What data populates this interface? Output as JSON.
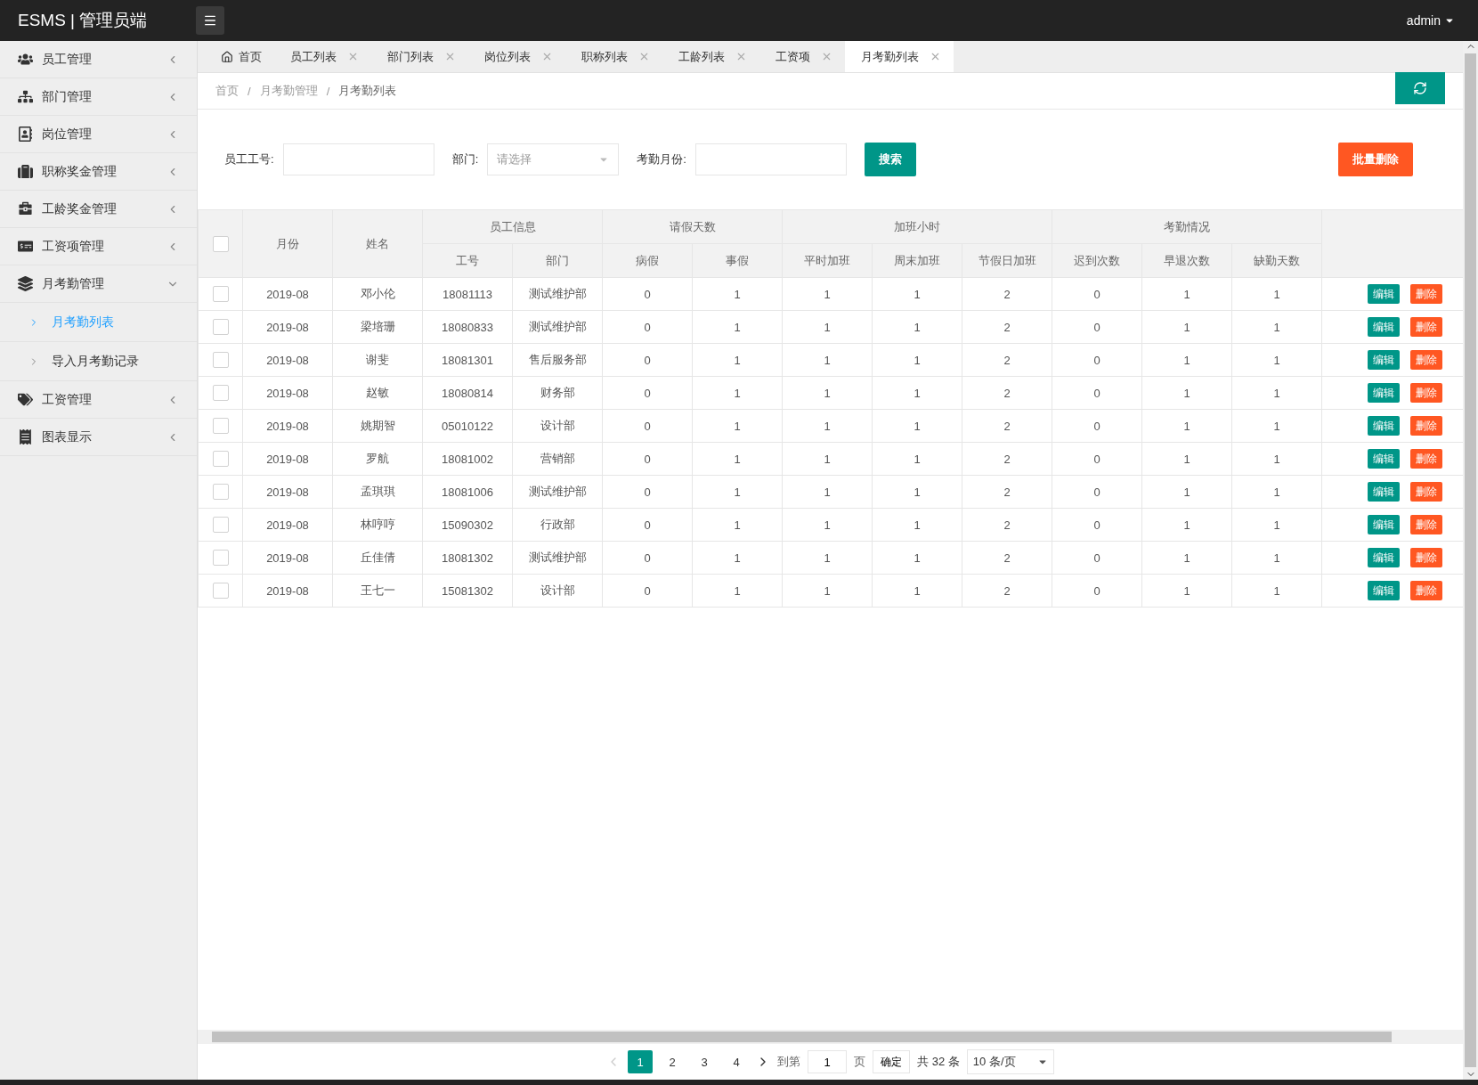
{
  "header": {
    "brand": "ESMS | 管理员端",
    "user": "admin"
  },
  "sidebar": {
    "items": [
      {
        "label": "员工管理",
        "expanded": false
      },
      {
        "label": "部门管理",
        "expanded": false
      },
      {
        "label": "岗位管理",
        "expanded": false
      },
      {
        "label": "职称奖金管理",
        "expanded": false
      },
      {
        "label": "工龄奖金管理",
        "expanded": false
      },
      {
        "label": "工资项管理",
        "expanded": false
      },
      {
        "label": "月考勤管理",
        "expanded": true,
        "children": [
          {
            "label": "月考勤列表",
            "selected": true
          },
          {
            "label": "导入月考勤记录",
            "selected": false
          }
        ]
      },
      {
        "label": "工资管理",
        "expanded": false
      },
      {
        "label": "图表显示",
        "expanded": false
      }
    ]
  },
  "tabs": [
    {
      "kind": "home",
      "label": "首页",
      "selected": false
    },
    {
      "kind": "page",
      "label": "员工列表",
      "selected": false
    },
    {
      "kind": "page",
      "label": "部门列表",
      "selected": false
    },
    {
      "kind": "page",
      "label": "岗位列表",
      "selected": false
    },
    {
      "kind": "page",
      "label": "职称列表",
      "selected": false
    },
    {
      "kind": "page",
      "label": "工龄列表",
      "selected": false
    },
    {
      "kind": "page",
      "label": "工资项",
      "selected": false
    },
    {
      "kind": "page",
      "label": "月考勤列表",
      "selected": true
    }
  ],
  "breadcrumb": [
    {
      "label": "首页"
    },
    {
      "separator": "/",
      "label": "月考勤管理"
    },
    {
      "separator": "/",
      "label": "月考勤列表"
    }
  ],
  "search": {
    "fields": [
      {
        "kind": "input",
        "label": "员工工号:"
      },
      {
        "kind": "select",
        "label": "部门:",
        "placeholder": "请选择"
      },
      {
        "kind": "input",
        "label": "考勤月份:"
      }
    ],
    "search_button": "搜索",
    "batch_delete_button": "批量删除"
  },
  "table": {
    "header_checked": false,
    "header": [
      {
        "label": "月份"
      },
      {
        "label": "姓名"
      },
      {
        "label": "员工信息",
        "children": [
          "工号",
          "部门"
        ]
      },
      {
        "label": "请假天数",
        "children": [
          "病假",
          "事假"
        ]
      },
      {
        "label": "加班小时",
        "children": [
          "平时加班",
          "周末加班",
          "节假日加班"
        ]
      },
      {
        "label": "考勤情况",
        "children": [
          "迟到次数",
          "早退次数",
          "缺勤天数"
        ]
      }
    ],
    "rows": [
      {
        "checked": false,
        "cells": [
          "2019-08",
          "邓小伦",
          "18081113",
          "测试维护部",
          "0",
          "1",
          "1",
          "1",
          "2",
          "0",
          "1",
          "1"
        ],
        "actions": [
          "编辑",
          "删除"
        ]
      },
      {
        "checked": false,
        "cells": [
          "2019-08",
          "梁培珊",
          "18080833",
          "测试维护部",
          "0",
          "1",
          "1",
          "1",
          "2",
          "0",
          "1",
          "1"
        ],
        "actions": [
          "编辑",
          "删除"
        ]
      },
      {
        "checked": false,
        "cells": [
          "2019-08",
          "谢斐",
          "18081301",
          "售后服务部",
          "0",
          "1",
          "1",
          "1",
          "2",
          "0",
          "1",
          "1"
        ],
        "actions": [
          "编辑",
          "删除"
        ]
      },
      {
        "checked": false,
        "cells": [
          "2019-08",
          "赵敏",
          "18080814",
          "财务部",
          "0",
          "1",
          "1",
          "1",
          "2",
          "0",
          "1",
          "1"
        ],
        "actions": [
          "编辑",
          "删除"
        ]
      },
      {
        "checked": false,
        "cells": [
          "2019-08",
          "姚期智",
          "05010122",
          "设计部",
          "0",
          "1",
          "1",
          "1",
          "2",
          "0",
          "1",
          "1"
        ],
        "actions": [
          "编辑",
          "删除"
        ]
      },
      {
        "checked": false,
        "cells": [
          "2019-08",
          "罗航",
          "18081002",
          "营销部",
          "0",
          "1",
          "1",
          "1",
          "2",
          "0",
          "1",
          "1"
        ],
        "actions": [
          "编辑",
          "删除"
        ]
      },
      {
        "checked": false,
        "cells": [
          "2019-08",
          "孟琪琪",
          "18081006",
          "测试维护部",
          "0",
          "1",
          "1",
          "1",
          "2",
          "0",
          "1",
          "1"
        ],
        "actions": [
          "编辑",
          "删除"
        ]
      },
      {
        "checked": false,
        "cells": [
          "2019-08",
          "林哼哼",
          "15090302",
          "行政部",
          "0",
          "1",
          "1",
          "1",
          "2",
          "0",
          "1",
          "1"
        ],
        "actions": [
          "编辑",
          "删除"
        ]
      },
      {
        "checked": false,
        "cells": [
          "2019-08",
          "丘佳倩",
          "18081302",
          "测试维护部",
          "0",
          "1",
          "1",
          "1",
          "2",
          "0",
          "1",
          "1"
        ],
        "actions": [
          "编辑",
          "删除"
        ]
      },
      {
        "checked": false,
        "cells": [
          "2019-08",
          "王七一",
          "15081302",
          "设计部",
          "0",
          "1",
          "1",
          "1",
          "2",
          "0",
          "1",
          "1"
        ],
        "actions": [
          "编辑",
          "删除"
        ]
      }
    ]
  },
  "pagination": {
    "pages": [
      {
        "label": "1",
        "selected": true
      },
      {
        "label": "2",
        "selected": false
      },
      {
        "label": "3",
        "selected": false
      },
      {
        "label": "4",
        "selected": false
      }
    ],
    "goto_label": "到第",
    "goto_value": "1",
    "page_label": "页",
    "confirm": "确定",
    "total": "共 32 条",
    "page_size": "10 条/页"
  }
}
